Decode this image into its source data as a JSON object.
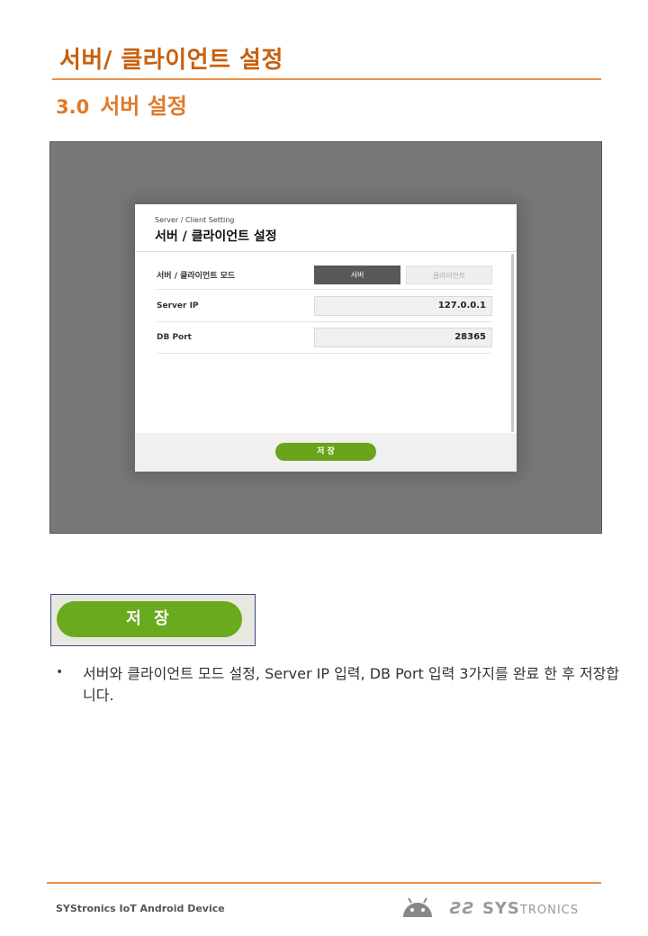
{
  "page": {
    "title": "서버/ 클라이언트 설정",
    "section_number": "3.0",
    "section_title": "서버 설정"
  },
  "dialog": {
    "subtitle": "Server / Client Setting",
    "title": "서버 / 클라이언트 설정",
    "rows": [
      {
        "label": "서버 / 클라이언트 모드",
        "option_selected": "서버",
        "option_other": "클라이언트"
      },
      {
        "label": "Server IP",
        "value": "127.0.0.1"
      },
      {
        "label": "DB Port",
        "value": "28365"
      }
    ],
    "save_label": "저 장"
  },
  "callout": {
    "save_label": "저 장"
  },
  "description": {
    "bullet": "•",
    "text": "서버와 클라이언트 모드 설정, Server IP 입력, DB Port 입력 3가지를 완료 한 후 저장합니다."
  },
  "footer": {
    "text": "SYStronics IoT Android Device",
    "brand_logo": "SYSTRONICS",
    "android_icon": "android-icon"
  },
  "colors": {
    "title": "#c8600f",
    "accent": "#e8904a",
    "save_green": "#6aa41a"
  }
}
